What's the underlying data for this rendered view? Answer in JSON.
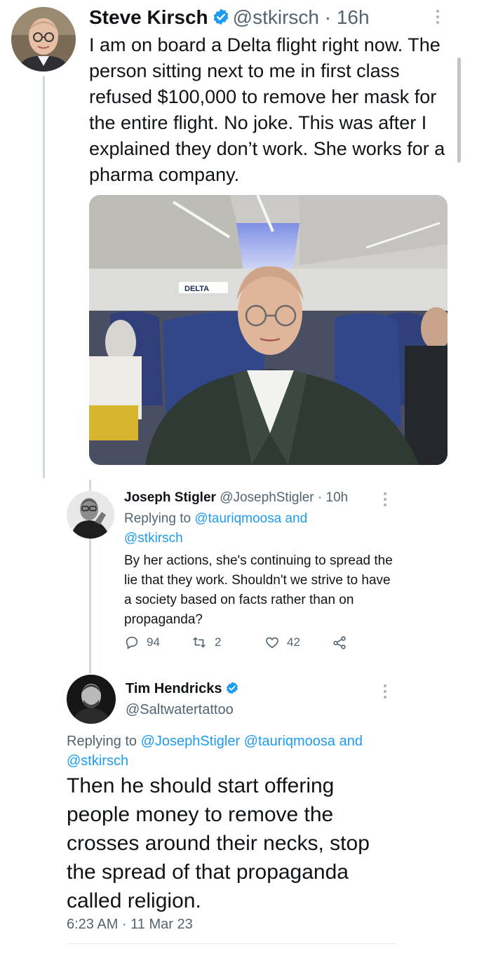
{
  "tweet1": {
    "name": "Steve Kirsch",
    "handle": "@stkirsch",
    "separator": "·",
    "time": "16h",
    "body": "I am on board a Delta flight right now. The person sitting next to me in first class refused $100,000 to remove her mask for the entire flight. No joke. This was after I explained they don’t work. She works for a pharma company.",
    "media_sign": "DELTA"
  },
  "tweet2": {
    "name": "Joseph Stigler",
    "handle": "@JosephStigler",
    "separator": "·",
    "time": "10h",
    "replying_prefix": "Replying to",
    "replying_link1": "@tauriqmoosa",
    "replying_and": "and",
    "replying_link2": "@stkirsch",
    "body": "By her actions, she's continuing to spread the lie that they work. Shouldn't we strive to have a society based on facts rather than on propaganda?",
    "replies": "94",
    "retweets": "2",
    "likes": "42"
  },
  "tweet3": {
    "name": "Tim Hendricks",
    "handle": "@Saltwatertattoo",
    "replying_prefix": "Replying to",
    "replying_link1": "@JosephStigler",
    "replying_link2": "@tauriqmoosa",
    "replying_and": "and",
    "replying_link3": "@stkirsch",
    "body": "Then he should start offering people money to remove the crosses around their necks, stop the spread of that propaganda called religion.",
    "timestamp": "6:23 AM · 11 Mar 23"
  },
  "colors": {
    "link": "#1d9bf0",
    "secondary_text": "#536471",
    "thread_line": "#cfd9de",
    "verified": "#1d9bf0"
  }
}
